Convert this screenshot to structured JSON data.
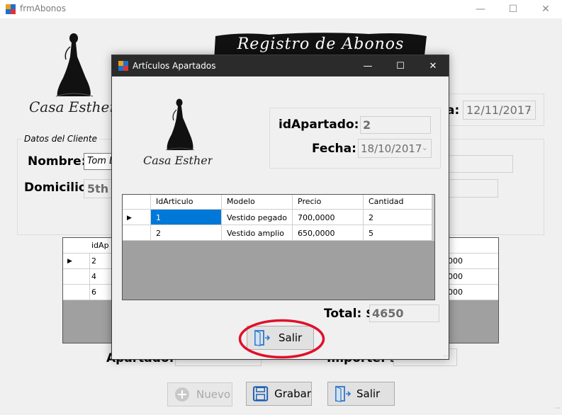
{
  "main_window": {
    "title": "frmAbonos",
    "banner_text": "Registro de Abonos",
    "logo_text": "Casa Esther",
    "date_label_tail": "a:",
    "date_value": "12/11/2017",
    "datos_legend": "Datos del Cliente",
    "nombre_label": "Nombre:",
    "nombre_value": "Tom L",
    "domicilio_label": "Domicilio:",
    "domicilio_value": "5th S",
    "grid": {
      "header": "idAp",
      "rows": [
        {
          "id": "2",
          "importe": "0000"
        },
        {
          "id": "4",
          "importe": "0000"
        },
        {
          "id": "6",
          "importe": "0000"
        }
      ]
    },
    "apartado_label": "Apartado:",
    "importe_label": "Importe: $",
    "buttons": {
      "nuevo": "Nuevo",
      "grabar": "Grabar",
      "salir": "Salir"
    }
  },
  "dialog": {
    "title": "Artículos Apartados",
    "logo_text": "Casa Esther",
    "idapartado_label": "idApartado:",
    "idapartado_value": "2",
    "fecha_label": "Fecha:",
    "fecha_value": "18/10/2017",
    "grid": {
      "columns": [
        "IdArticulo",
        "Modelo",
        "Precio",
        "Cantidad"
      ],
      "rows": [
        [
          "1",
          "Vestido pegado",
          "700,0000",
          "2"
        ],
        [
          "2",
          "Vestido amplio",
          "650,0000",
          "5"
        ]
      ]
    },
    "total_label": "Total: $",
    "total_value": "4650",
    "salir_label": "Salir"
  },
  "colors": {
    "dialog_titlebar": "#2b2b2b",
    "selected_cell": "#0078d7",
    "grid_background": "#a0a0a0",
    "annotation": "#e0102a"
  }
}
